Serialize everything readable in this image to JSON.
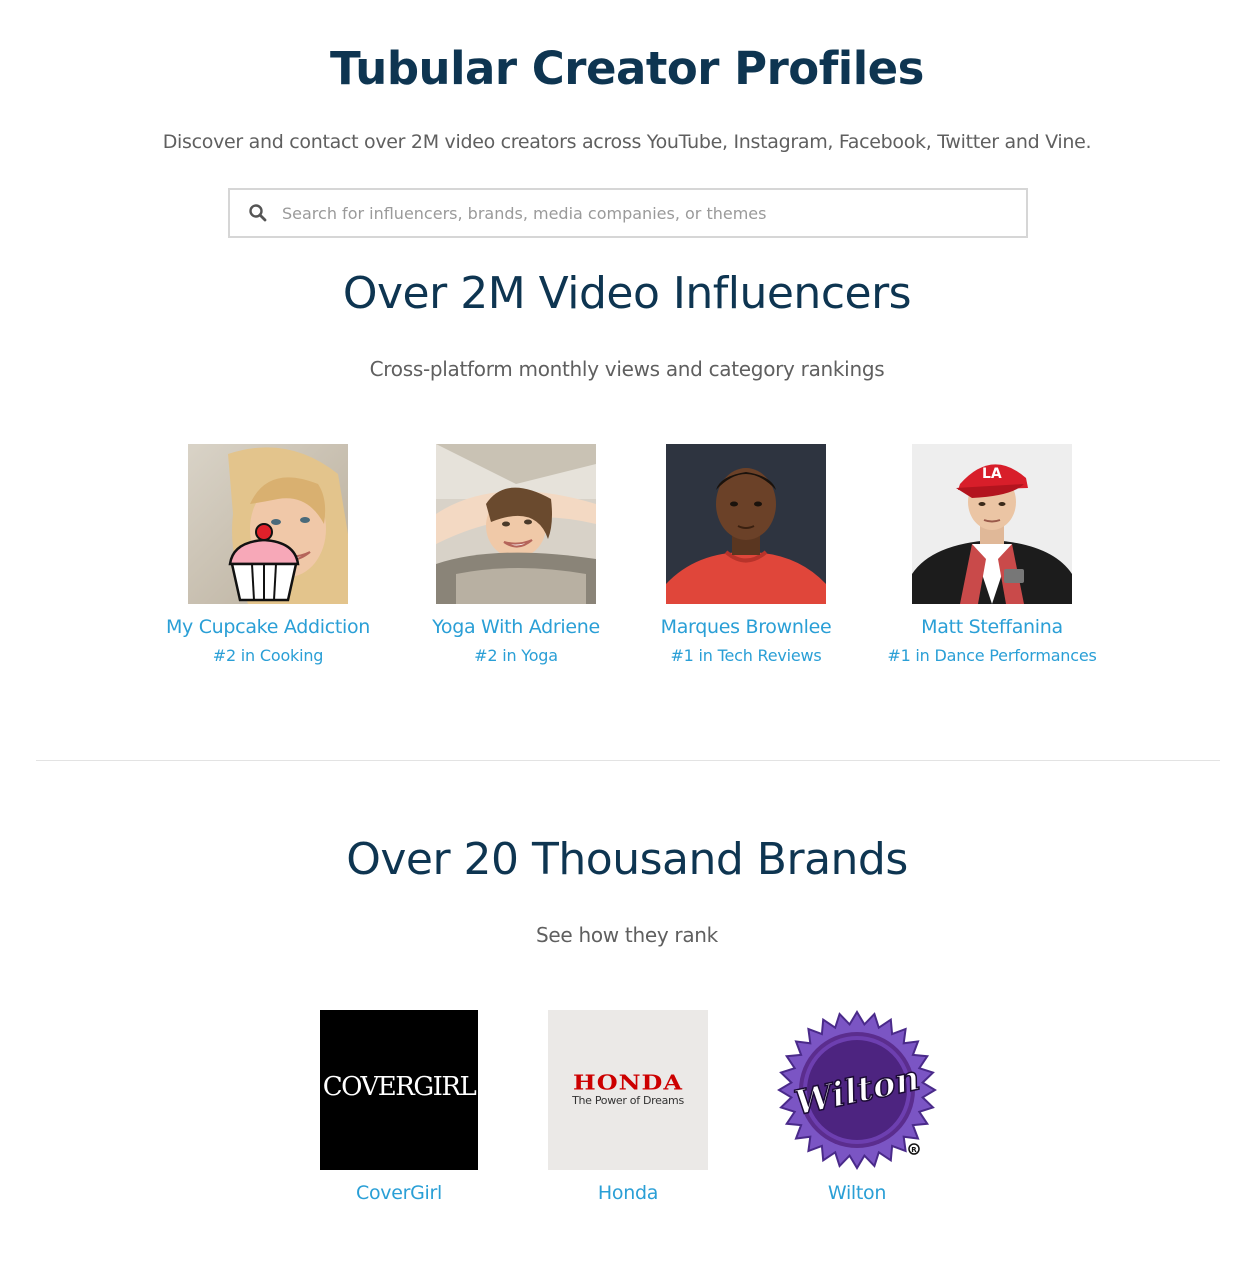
{
  "header": {
    "title": "Tubular Creator Profiles",
    "subtitle": "Discover and contact over 2M video creators across YouTube, Instagram, Facebook, Twitter and Vine.",
    "search_placeholder": "Search for influencers, brands, media companies, or themes",
    "search_value": ""
  },
  "influencers": {
    "heading": "Over 2M Video Influencers",
    "subheading": "Cross-platform monthly views and category rankings",
    "items": [
      {
        "name": "My Cupcake Addiction",
        "rank": "#2 in Cooking"
      },
      {
        "name": "Yoga With Adriene",
        "rank": "#2 in Yoga"
      },
      {
        "name": "Marques Brownlee",
        "rank": "#1 in Tech Reviews"
      },
      {
        "name": "Matt Steffanina",
        "rank": "#1 in Dance Performances"
      }
    ]
  },
  "brands": {
    "heading": "Over 20 Thousand Brands",
    "subheading": "See how they rank",
    "items": [
      {
        "name": "CoverGirl",
        "logo_text": "COVERGIRL"
      },
      {
        "name": "Honda",
        "logo_text": "HONDA",
        "logo_tagline": "The Power of Dreams"
      },
      {
        "name": "Wilton",
        "logo_text": "Wilton"
      }
    ]
  },
  "colors": {
    "title": "#0e3551",
    "link": "#2a9fd6",
    "text": "#5f5f5f",
    "honda_red": "#cc0000",
    "wilton_purple": "#5b2d8e"
  }
}
